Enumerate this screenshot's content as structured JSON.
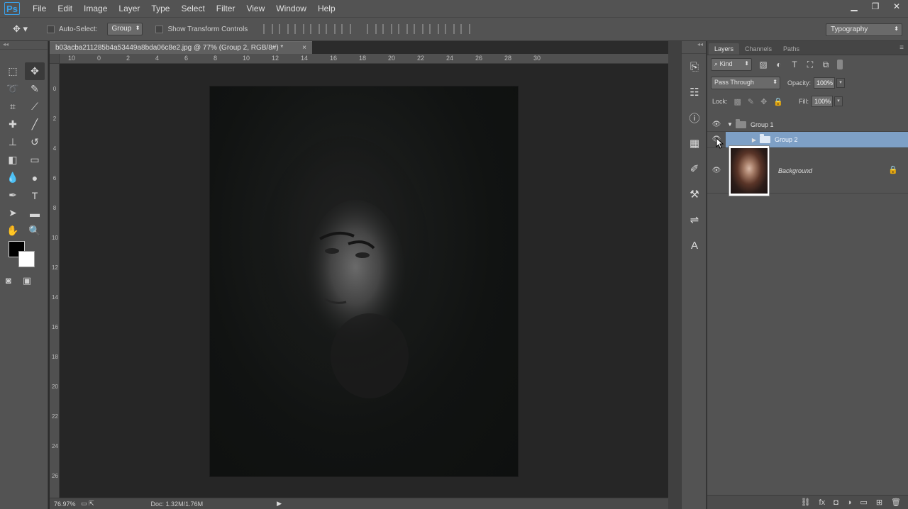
{
  "app": {
    "logo": "Ps"
  },
  "menu": [
    "File",
    "Edit",
    "Image",
    "Layer",
    "Type",
    "Select",
    "Filter",
    "View",
    "Window",
    "Help"
  ],
  "window_controls": {
    "minimize": "▁",
    "restore": "❐",
    "close": "✕"
  },
  "options": {
    "tool_icon": "move-tool-icon",
    "auto_select_label": "Auto-Select:",
    "auto_select_value": "Group",
    "show_transform_label": "Show Transform Controls",
    "workspace": "Typography"
  },
  "document": {
    "tab_title": "b03acba211285b4a53449a8bda06c8e2.jpg @ 77% (Group 2, RGB/8#) *",
    "close_glyph": "×",
    "ruler_h": [
      "10",
      "0",
      "2",
      "4",
      "6",
      "8",
      "10",
      "12",
      "14",
      "16",
      "18",
      "20",
      "22",
      "24",
      "26",
      "28",
      "30"
    ],
    "ruler_v": [
      "0",
      "2",
      "4",
      "6",
      "8",
      "10",
      "12",
      "14",
      "16",
      "18",
      "20",
      "22",
      "24",
      "26"
    ]
  },
  "status": {
    "zoom": "76.97%",
    "doc": "Doc: 1.32M/1.76M",
    "arrow": "▶"
  },
  "layers_panel": {
    "tabs": [
      "Layers",
      "Channels",
      "Paths"
    ],
    "filter_kind": "Kind",
    "blend_mode": "Pass Through",
    "opacity_label": "Opacity:",
    "opacity_value": "100%",
    "lock_label": "Lock:",
    "fill_label": "Fill:",
    "fill_value": "100%",
    "layers": [
      {
        "name": "Group 1",
        "type": "group",
        "expanded": true
      },
      {
        "name": "Group 2",
        "type": "group",
        "expanded": false,
        "selected": true
      },
      {
        "name": "Background",
        "type": "image",
        "locked": true
      }
    ]
  },
  "colors": {
    "accent": "#3aa0e8",
    "selected_layer": "#7ea0c6",
    "panel": "#535353",
    "canvas_bg": "#262626"
  }
}
